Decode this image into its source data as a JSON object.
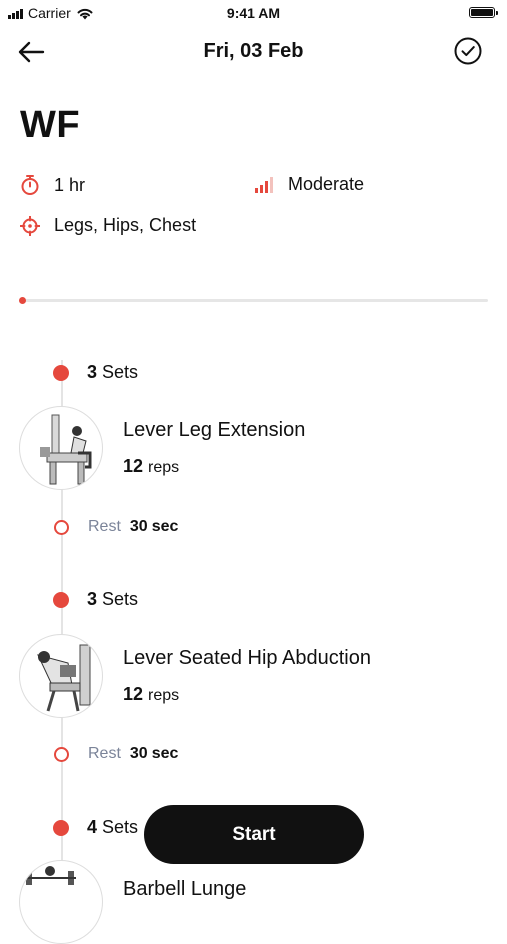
{
  "status_bar": {
    "carrier": "Carrier",
    "time": "9:41 AM"
  },
  "nav": {
    "title": "Fri, 03 Feb"
  },
  "workout": {
    "title": "WF",
    "duration": "1 hr",
    "intensity": "Moderate",
    "targets": "Legs, Hips, Chest",
    "progress_fraction": 0.0
  },
  "accent_color": "#e5483d",
  "exercises": [
    {
      "sets_count": "3",
      "sets_label": "Sets",
      "name": "Lever Leg Extension",
      "reps": "12",
      "reps_unit": "reps",
      "rest_label": "Rest",
      "rest_value": "30",
      "rest_unit": "sec"
    },
    {
      "sets_count": "3",
      "sets_label": "Sets",
      "name": "Lever Seated Hip Abduction",
      "reps": "12",
      "reps_unit": "reps",
      "rest_label": "Rest",
      "rest_value": "30",
      "rest_unit": "sec"
    },
    {
      "sets_count": "4",
      "sets_label": "Sets",
      "name": "Barbell Lunge"
    }
  ],
  "start_button": {
    "label": "Start"
  }
}
